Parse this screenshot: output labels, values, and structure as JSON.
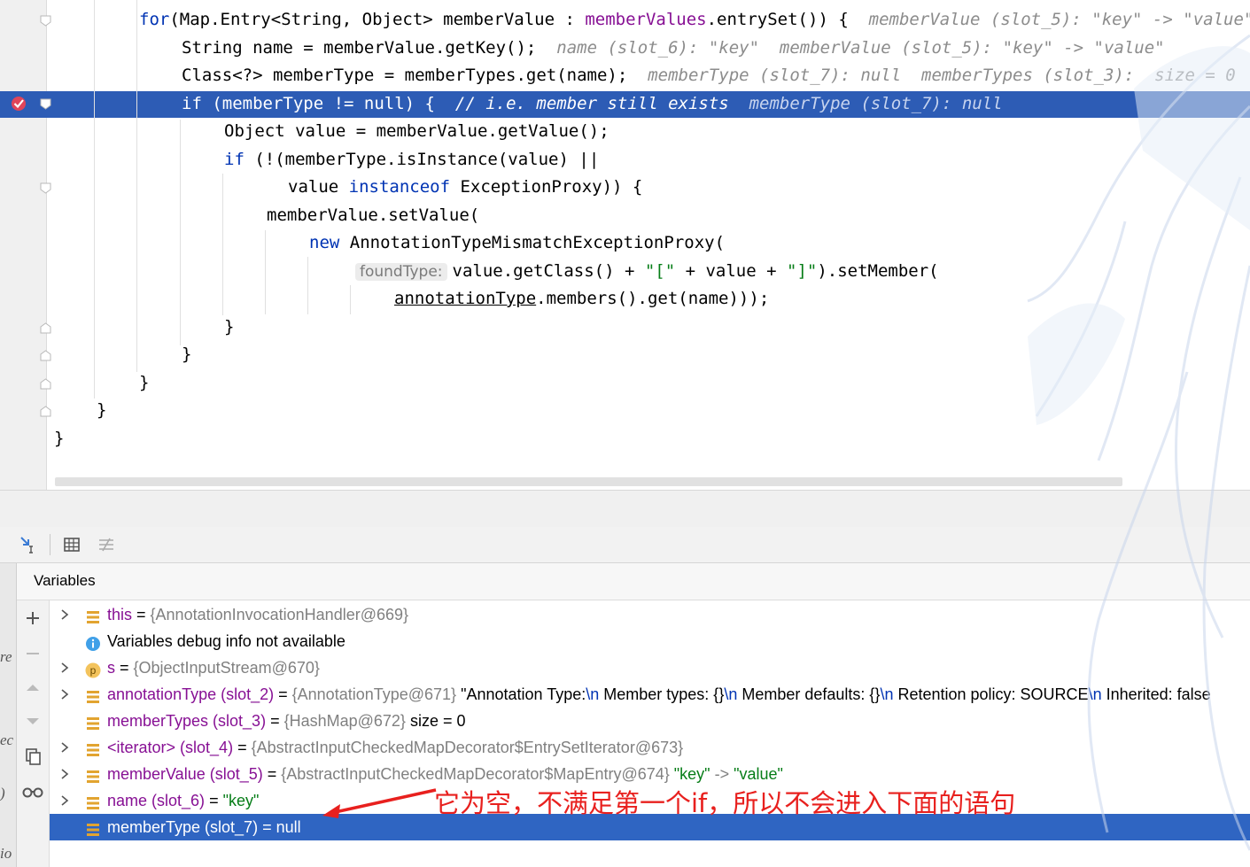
{
  "editor": {
    "lines": [
      {
        "id": "for",
        "parts": [
          [
            "kw",
            "for"
          ],
          [
            "",
            "(Map.Entry<String, Object> memberValue : "
          ],
          [
            "fld",
            "memberValues"
          ],
          [
            "",
            ".entrySet()) {  "
          ],
          [
            "hint",
            "memberValue (slot_5): \"key\" -> \"value\""
          ]
        ]
      },
      {
        "id": "name",
        "parts": [
          [
            "",
            "String name = memberValue.getKey();  "
          ],
          [
            "hint",
            "name (slot_6): \"key\"  memberValue (slot_5): \"key\" -> \"value\""
          ]
        ]
      },
      {
        "id": "class",
        "parts": [
          [
            "",
            "Class<?> memberType = memberTypes.get(name);  "
          ],
          [
            "hint",
            "memberType (slot_7): null  memberTypes (slot_3):  size = 0"
          ]
        ]
      },
      {
        "id": "if",
        "parts": [
          [
            "kw",
            "if"
          ],
          [
            "",
            " (memberType != null) {  "
          ],
          [
            "cmt",
            "// i.e. member still exists  "
          ],
          [
            "hint",
            "memberType (slot_7): null"
          ]
        ]
      },
      {
        "id": "obj",
        "parts": [
          [
            "",
            "Object value = memberValue.getValue();"
          ]
        ]
      },
      {
        "id": "if2",
        "parts": [
          [
            "kw",
            "if"
          ],
          [
            "",
            " (!(memberType.isInstance(value) ||"
          ]
        ]
      },
      {
        "id": "inst",
        "parts": [
          [
            "",
            "value "
          ],
          [
            "kw",
            "instanceof"
          ],
          [
            "",
            " ExceptionProxy)) {"
          ]
        ]
      },
      {
        "id": "set",
        "parts": [
          [
            "",
            "memberValue.setValue("
          ]
        ]
      },
      {
        "id": "new",
        "parts": [
          [
            "kw",
            "new"
          ],
          [
            "",
            " AnnotationTypeMismatchExceptionProxy("
          ]
        ]
      },
      {
        "id": "found",
        "hint": "foundType:",
        "parts": [
          [
            "",
            "value.getClass() + "
          ],
          [
            "str",
            "\"[\""
          ],
          [
            "",
            " + value + "
          ],
          [
            "str",
            "\"]\""
          ],
          [
            "",
            ").setMember("
          ]
        ]
      },
      {
        "id": "members",
        "parts": [
          [
            "ul",
            "annotationType"
          ],
          [
            "",
            ".members().get(name)));"
          ]
        ]
      },
      {
        "id": "close1",
        "parts": [
          [
            "",
            "}"
          ]
        ]
      },
      {
        "id": "close2",
        "parts": [
          [
            "",
            "}"
          ]
        ]
      },
      {
        "id": "close3",
        "parts": [
          [
            "",
            "}"
          ]
        ]
      },
      {
        "id": "close4",
        "parts": [
          [
            "",
            "}"
          ]
        ]
      },
      {
        "id": "close5",
        "parts": [
          [
            "",
            "}"
          ]
        ]
      }
    ]
  },
  "debugger": {
    "panel_title": "Variables",
    "left_strip_fragments": [
      "re",
      "ec",
      ")",
      "io"
    ],
    "variables": [
      {
        "icon": "field",
        "expandable": true,
        "name": "this",
        "eq": " = ",
        "value": "{AnnotationInvocationHandler@669}",
        "extra": []
      },
      {
        "icon": "info",
        "expandable": false,
        "name": "",
        "eq": "",
        "value": "",
        "plain": "Variables debug info not available",
        "extra": []
      },
      {
        "icon": "param",
        "expandable": true,
        "name": "s",
        "eq": " = ",
        "value": "{ObjectInputStream@670}",
        "extra": []
      },
      {
        "icon": "field",
        "expandable": true,
        "name": "annotationType (slot_2)",
        "eq": " = ",
        "value": "{AnnotationType@671}",
        "extra": [
          [
            "plain",
            " \"Annotation Type:"
          ],
          [
            "nl",
            "\\n"
          ],
          [
            "plain",
            "   Member types: {}"
          ],
          [
            "nl",
            "\\n"
          ],
          [
            "plain",
            "   Member defaults: {}"
          ],
          [
            "nl",
            "\\n"
          ],
          [
            "plain",
            "   Retention policy: SOURCE"
          ],
          [
            "nl",
            "\\n"
          ],
          [
            "plain",
            "   Inherited: false"
          ]
        ]
      },
      {
        "icon": "field",
        "expandable": false,
        "name": "memberTypes (slot_3)",
        "eq": " = ",
        "value": "{HashMap@672}",
        "extra": [
          [
            "plain",
            "  size = 0"
          ]
        ]
      },
      {
        "icon": "field",
        "expandable": true,
        "name": "<iterator> (slot_4)",
        "eq": " = ",
        "value": "{AbstractInputCheckedMapDecorator$EntrySetIterator@673}",
        "extra": []
      },
      {
        "icon": "field",
        "expandable": true,
        "name": "memberValue (slot_5)",
        "eq": " = ",
        "value": "{AbstractInputCheckedMapDecorator$MapEntry@674}",
        "extra": [
          [
            "str",
            " \"key\""
          ],
          [
            "val",
            " -> "
          ],
          [
            "str",
            "\"value\""
          ]
        ]
      },
      {
        "icon": "field",
        "expandable": true,
        "name": "name (slot_6)",
        "eq": " = ",
        "value": "",
        "extra": [
          [
            "str",
            "\"key\""
          ]
        ]
      },
      {
        "icon": "field",
        "expandable": false,
        "name": "memberType (slot_7)",
        "eq": " = ",
        "value": "",
        "extra": [
          [
            "plain",
            "null"
          ]
        ],
        "selected": true
      }
    ],
    "annotation_text": "它为空，不满足第一个if，所以不会进入下面的语句",
    "colors": {
      "selection": "#2f65c2",
      "annotation": "#e8201e",
      "execution_line": "#2d5cb5"
    }
  }
}
